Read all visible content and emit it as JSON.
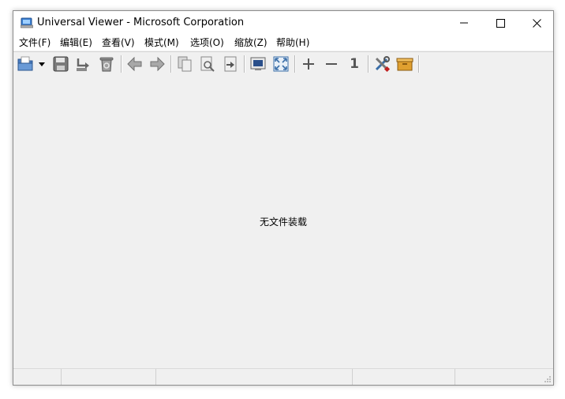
{
  "window": {
    "title": "Universal Viewer - Microsoft Corporation"
  },
  "menu": {
    "items": [
      {
        "label": "文件(F)"
      },
      {
        "label": "编辑(E)"
      },
      {
        "label": "查看(V)"
      },
      {
        "label": "模式(M)"
      },
      {
        "label": "选项(O)"
      },
      {
        "label": "缩放(Z)"
      },
      {
        "label": "帮助(H)"
      }
    ]
  },
  "toolbar": {
    "buttons": [
      {
        "icon": "open-folder-icon"
      },
      {
        "icon": "dropdown-arrow-icon"
      },
      {
        "icon": "save-icon"
      },
      {
        "icon": "reload-icon"
      },
      {
        "icon": "delete-icon"
      },
      {
        "icon": "back-icon"
      },
      {
        "icon": "forward-icon"
      },
      {
        "icon": "copy-icon"
      },
      {
        "icon": "find-icon"
      },
      {
        "icon": "goto-icon"
      },
      {
        "icon": "fit-window-icon"
      },
      {
        "icon": "fullscreen-icon"
      },
      {
        "icon": "zoom-in-icon"
      },
      {
        "icon": "zoom-out-icon"
      },
      {
        "icon": "original-size-icon"
      },
      {
        "icon": "settings-tools-icon"
      },
      {
        "icon": "plugin-box-icon"
      }
    ],
    "original_size_label": "1"
  },
  "content": {
    "empty_message": "无文件装载"
  },
  "colors": {
    "client_bg": "#f0f0f0",
    "titlebar_bg": "#ffffff",
    "folder_blue": "#4a7cc0",
    "box_orange": "#e0a030"
  }
}
